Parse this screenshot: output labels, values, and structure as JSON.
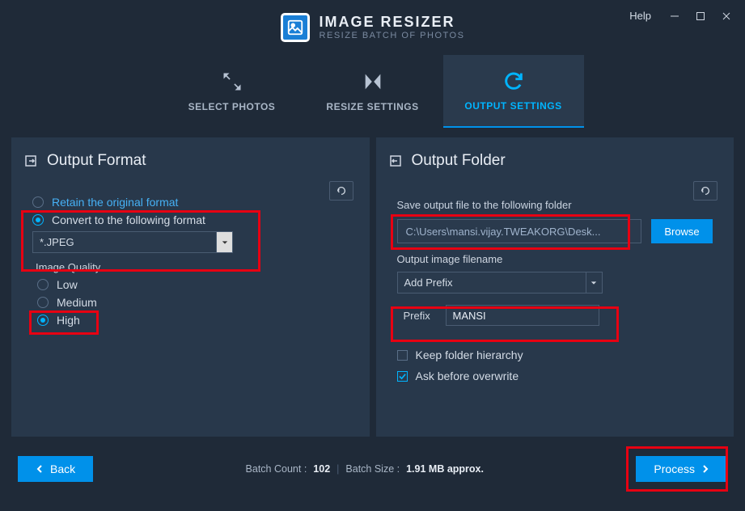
{
  "titlebar": {
    "app_title": "IMAGE RESIZER",
    "app_subtitle": "RESIZE BATCH OF PHOTOS",
    "help_label": "Help"
  },
  "tabs": {
    "select_photos": "SELECT PHOTOS",
    "resize_settings": "RESIZE SETTINGS",
    "output_settings": "OUTPUT SETTINGS"
  },
  "format_panel": {
    "title": "Output Format",
    "retain_label": "Retain the original format",
    "convert_label": "Convert to the following format",
    "convert_value": "*.JPEG",
    "quality_label": "Image Quality",
    "quality_options": {
      "low": "Low",
      "medium": "Medium",
      "high": "High"
    }
  },
  "folder_panel": {
    "title": "Output Folder",
    "save_label": "Save output file to the following folder",
    "path_value": "C:\\Users\\mansi.vijay.TWEAKORG\\Desk...",
    "browse_label": "Browse",
    "filename_label": "Output image filename",
    "filename_select_value": "Add Prefix",
    "prefix_label": "Prefix",
    "prefix_value": "MANSI",
    "keep_hierarchy_label": "Keep folder hierarchy",
    "ask_overwrite_label": "Ask before overwrite"
  },
  "footer": {
    "back_label": "Back",
    "process_label": "Process",
    "batch_count_label": "Batch Count :",
    "batch_count_value": "102",
    "batch_size_label": "Batch Size :",
    "batch_size_value": "1.91 MB approx."
  }
}
